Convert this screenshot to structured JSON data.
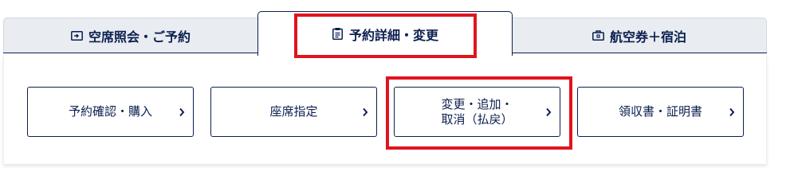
{
  "tabs": [
    {
      "label": "空席照会・ご予約",
      "icon": "ticket-icon",
      "active": false
    },
    {
      "label": "予約詳細・変更",
      "icon": "document-icon",
      "active": true
    },
    {
      "label": "航空券＋宿泊",
      "icon": "suitcase-icon",
      "active": false
    }
  ],
  "buttons": [
    {
      "label": "予約確認・購入",
      "icon": "chevron-right-icon"
    },
    {
      "label": "座席指定",
      "icon": "chevron-right-icon"
    },
    {
      "label": "変更・追加・\n取消（払戻）",
      "icon": "chevron-right-icon"
    },
    {
      "label": "領収書・証明書",
      "icon": "chevron-right-icon"
    }
  ],
  "colors": {
    "navy": "#0b1f4f",
    "inactive_tab_bg": "#e9ecf1",
    "highlight": "#e0141e"
  }
}
